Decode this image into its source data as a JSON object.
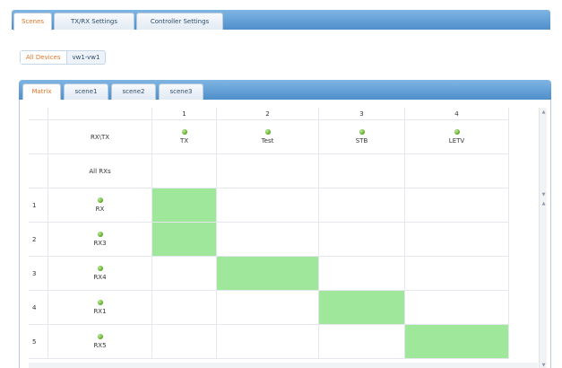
{
  "top_tabs": [
    {
      "label": "Scenes",
      "active": true
    },
    {
      "label": "TX/RX Settings",
      "active": false
    },
    {
      "label": "Controller Settings",
      "active": false
    }
  ],
  "device_tabs": [
    {
      "label": "All Devices",
      "active": true
    },
    {
      "label": "vw1-vw1",
      "active": false
    }
  ],
  "scene_tabs": [
    {
      "label": "Matrix",
      "active": true
    },
    {
      "label": "scene1",
      "active": false
    },
    {
      "label": "scene2",
      "active": false
    },
    {
      "label": "scene3",
      "active": false
    }
  ],
  "matrix": {
    "corner_label": "RX\\TX",
    "all_rx_label": "All RXs",
    "tx_columns": [
      {
        "index": "1",
        "name": "TX"
      },
      {
        "index": "2",
        "name": "Test"
      },
      {
        "index": "3",
        "name": "STB"
      },
      {
        "index": "4",
        "name": "LETV"
      }
    ],
    "rx_rows": [
      {
        "index": "1",
        "name": "RX",
        "routed_tx": 1
      },
      {
        "index": "2",
        "name": "RX3",
        "routed_tx": 1
      },
      {
        "index": "3",
        "name": "RX4",
        "routed_tx": 2
      },
      {
        "index": "4",
        "name": "RX1",
        "routed_tx": 3
      },
      {
        "index": "5",
        "name": "RX5",
        "routed_tx": 4
      }
    ],
    "active_color": "#9fe79a",
    "status_icon": "green-status-dot-icon"
  },
  "scroll_icons": {
    "up": "▲",
    "down": "▼"
  }
}
